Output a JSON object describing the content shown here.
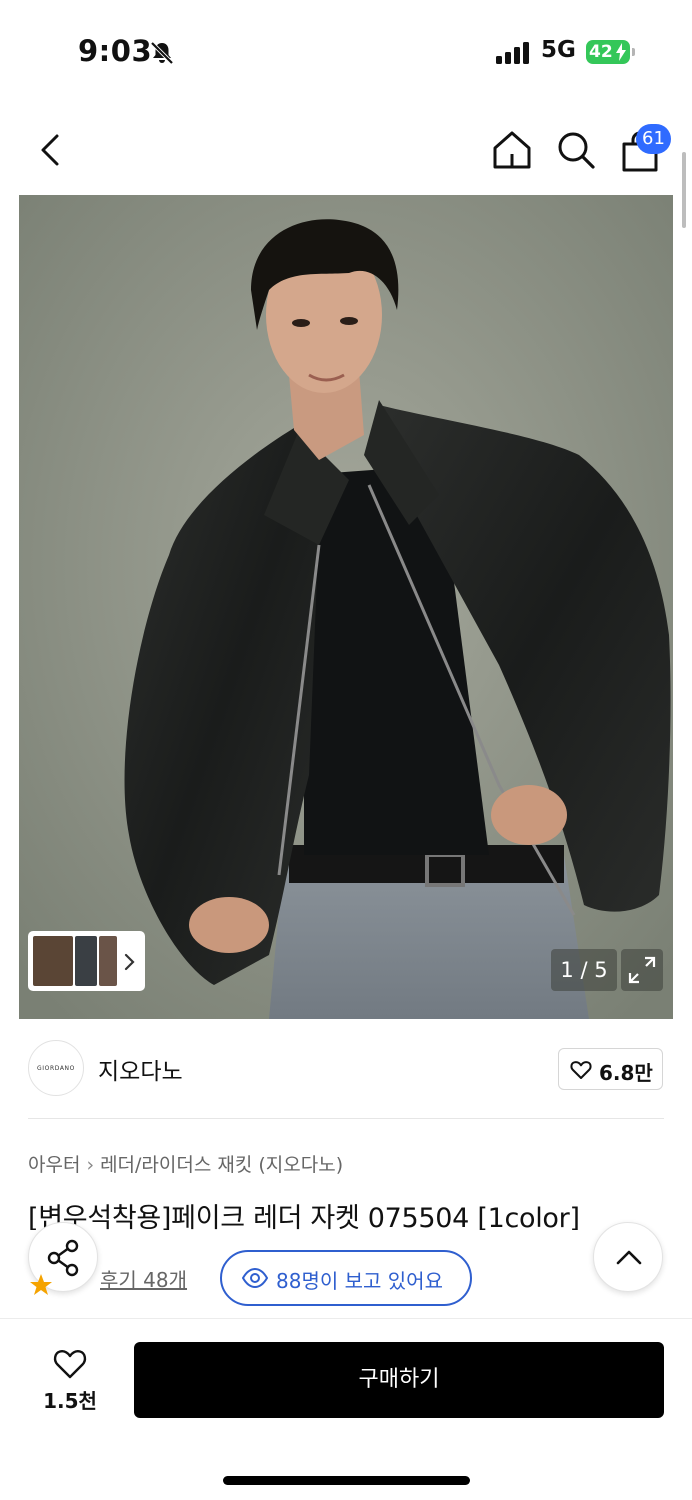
{
  "status_bar": {
    "time": "9:03",
    "network": "5G",
    "battery": "42"
  },
  "nav": {
    "cart_badge": "61"
  },
  "gallery": {
    "counter": "1 / 5"
  },
  "seller": {
    "logo_text": "GIORDANO",
    "name": "지오다노",
    "favorite_count": "6.8만"
  },
  "breadcrumb": {
    "level1": "아우터",
    "level2": "레더/라이더스 재킷 (지오다노)"
  },
  "product": {
    "title": "[변우석착용]페이크 레더 자켓 075504 [1color]"
  },
  "reviews": {
    "label": "후기 48개"
  },
  "viewers": {
    "text": "88명이 보고 있어요"
  },
  "bottom_bar": {
    "wish_count": "1.5천",
    "buy_label": "구매하기"
  },
  "colors": {
    "accent_blue": "#2f5fcf",
    "badge_blue": "#2f6bff",
    "battery_green": "#34c759",
    "buy_black": "#000000"
  }
}
